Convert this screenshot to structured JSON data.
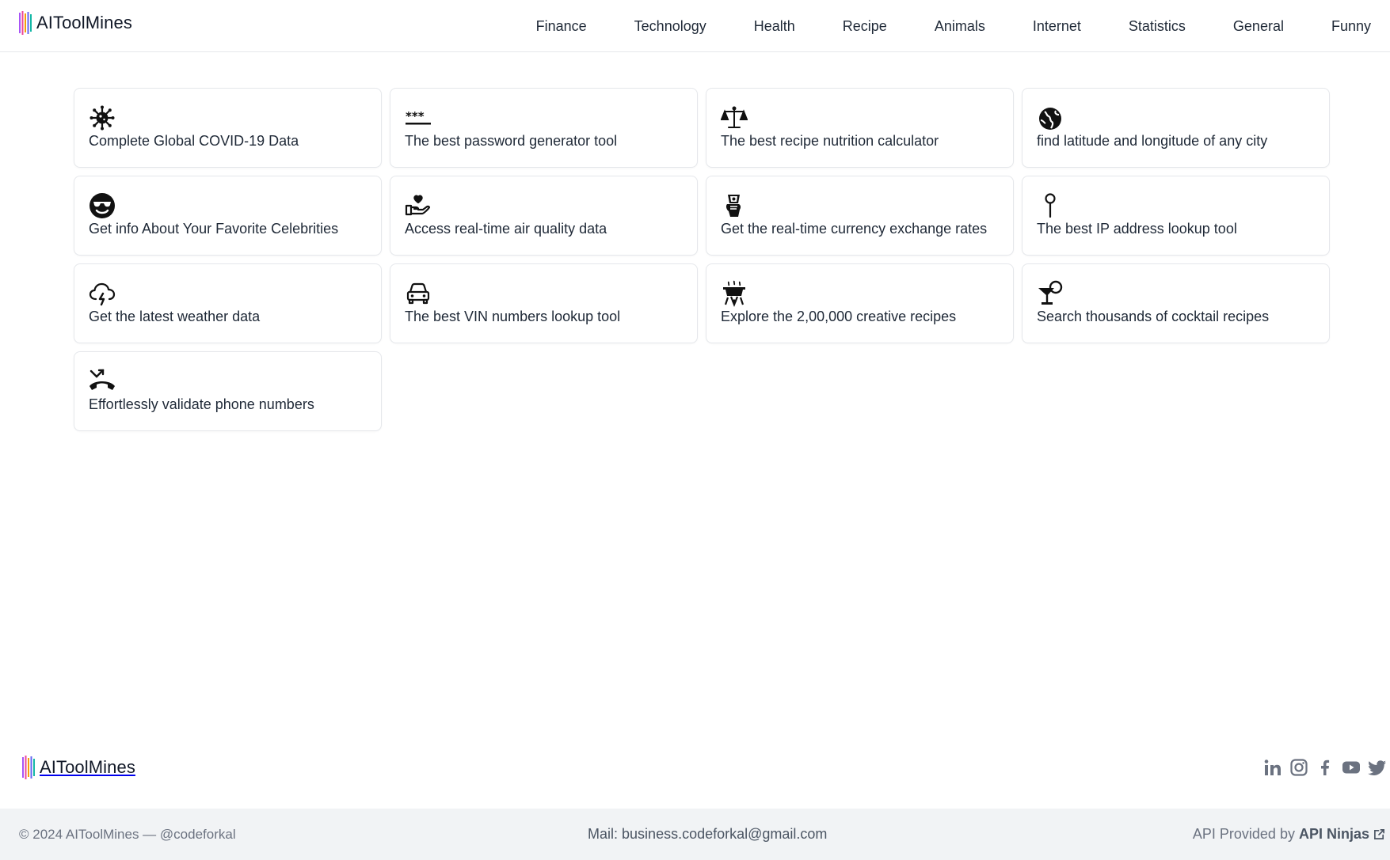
{
  "brand": {
    "name": "AIToolMines",
    "bar_colors": [
      "#a855f7",
      "#ec4899",
      "#f59e0b",
      "#6366f1",
      "#14b8a6"
    ]
  },
  "nav": {
    "items": [
      {
        "label": "Finance"
      },
      {
        "label": "Technology"
      },
      {
        "label": "Health"
      },
      {
        "label": "Recipe"
      },
      {
        "label": "Animals"
      },
      {
        "label": "Internet"
      },
      {
        "label": "Statistics"
      },
      {
        "label": "General"
      },
      {
        "label": "Funny"
      }
    ]
  },
  "cards": [
    {
      "title": "Complete Global COVID-19 Data",
      "icon": "virus-icon"
    },
    {
      "title": "The best password generator tool",
      "icon": "password-icon"
    },
    {
      "title": "The best recipe nutrition calculator",
      "icon": "scale-icon"
    },
    {
      "title": "find latitude and longitude of any city",
      "icon": "globe-icon"
    },
    {
      "title": "Get info About Your Favorite Celebrities",
      "icon": "sunglasses-face-icon"
    },
    {
      "title": "Access real-time air quality data",
      "icon": "hand-heart-icon"
    },
    {
      "title": "Get the real-time currency exchange rates",
      "icon": "money-hand-icon"
    },
    {
      "title": "The best IP address lookup tool",
      "icon": "map-pin-icon"
    },
    {
      "title": "Get the latest weather data",
      "icon": "cloud-lightning-icon"
    },
    {
      "title": "The best VIN numbers lookup tool",
      "icon": "car-icon"
    },
    {
      "title": "Explore the 2,00,000 creative recipes",
      "icon": "cooking-pot-icon"
    },
    {
      "title": "Search thousands of cocktail recipes",
      "icon": "cocktail-icon"
    },
    {
      "title": "Effortlessly validate phone numbers",
      "icon": "phone-missed-icon"
    }
  ],
  "footer": {
    "brand_name": "AIToolMines",
    "social": [
      "linkedin-icon",
      "instagram-icon",
      "facebook-icon",
      "youtube-icon",
      "twitter-icon"
    ],
    "copyright_prefix": "© 2024 AIToolMines —",
    "copyright_handle": "@codeforkal",
    "mail_label": "Mail:",
    "mail_address": "business.codeforkal@gmail.com",
    "api_prefix": "API Provided by",
    "api_name": "API Ninjas"
  },
  "colors": {
    "text": "#1f2937",
    "muted": "#6b7280",
    "border": "#e5e7eb",
    "footer_bg": "#f1f3f5",
    "social": "#6b7280"
  }
}
